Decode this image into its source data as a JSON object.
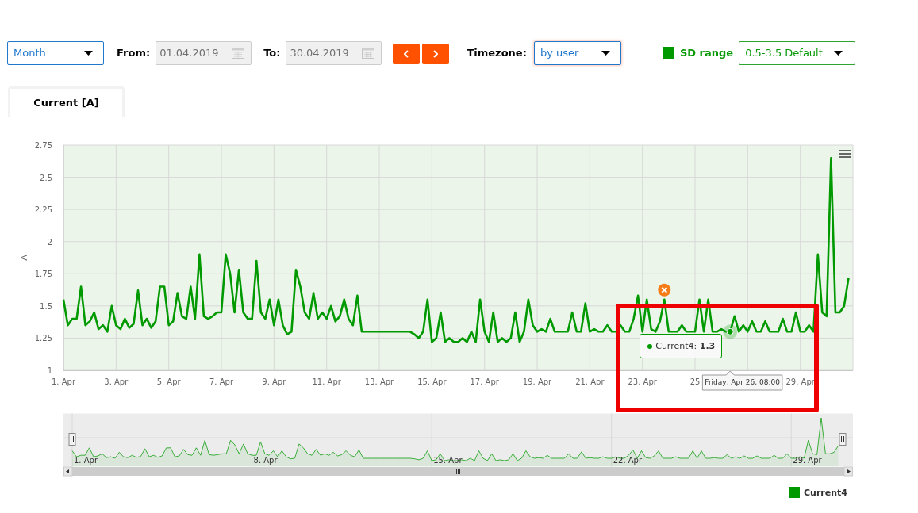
{
  "toolbar": {
    "period": {
      "value": "Month",
      "focused": false
    },
    "from": {
      "label": "From:",
      "value": "01.04.2019",
      "disabled": true
    },
    "to": {
      "label": "To:",
      "value": "30.04.2019",
      "disabled": true
    },
    "steps": [
      {
        "kind": "prev"
      },
      {
        "kind": "next"
      }
    ],
    "timezone": {
      "label": "Timezone:",
      "value": "by user",
      "focused": true
    },
    "sd_range": {
      "label": "SD range",
      "value": "0.5-3.5 Default"
    }
  },
  "tabs": [
    {
      "label": "Current [A]",
      "selected": true
    }
  ],
  "chart": {
    "chart_data": {
      "type": "line",
      "ylabel": "A",
      "grid": true,
      "categories": [
        "1. Apr",
        null,
        null,
        null,
        null,
        null,
        null,
        null,
        null,
        null,
        null,
        null,
        "3. Apr",
        null,
        null,
        null,
        null,
        null,
        null,
        null,
        null,
        null,
        null,
        null,
        "5. Apr",
        null,
        null,
        null,
        null,
        null,
        null,
        null,
        null,
        null,
        null,
        null,
        "7. Apr",
        null,
        null,
        null,
        null,
        null,
        null,
        null,
        null,
        null,
        null,
        null,
        "9. Apr",
        null,
        null,
        null,
        null,
        null,
        null,
        null,
        null,
        null,
        null,
        null,
        "11. Apr",
        null,
        null,
        null,
        null,
        null,
        null,
        null,
        null,
        null,
        null,
        null,
        "13. Apr",
        null,
        null,
        null,
        null,
        null,
        null,
        null,
        null,
        null,
        null,
        null,
        "15. Apr",
        null,
        null,
        null,
        null,
        null,
        null,
        null,
        null,
        null,
        null,
        null,
        "17. Apr",
        null,
        null,
        null,
        null,
        null,
        null,
        null,
        null,
        null,
        null,
        null,
        "19. Apr",
        null,
        null,
        null,
        null,
        null,
        null,
        null,
        null,
        null,
        null,
        null,
        "21. Apr",
        null,
        null,
        null,
        null,
        null,
        null,
        null,
        null,
        null,
        null,
        null,
        "23. Apr",
        null,
        null,
        null,
        null,
        null,
        null,
        null,
        null,
        null,
        null,
        null,
        "25",
        null,
        null,
        null,
        null,
        null,
        null,
        null,
        null,
        null,
        null,
        null,
        null,
        null,
        null,
        null,
        null,
        null,
        null,
        null,
        null,
        null,
        null,
        null,
        "29. Apr",
        null,
        null,
        null,
        null,
        null,
        null,
        null,
        null,
        null,
        null,
        null
      ],
      "series": [
        {
          "name": "Current4",
          "color": "#009900",
          "values": [
            1.55,
            1.35,
            1.4,
            1.4,
            1.65,
            1.35,
            1.38,
            1.45,
            1.32,
            1.35,
            1.3,
            1.5,
            1.35,
            1.32,
            1.4,
            1.33,
            1.36,
            1.62,
            1.35,
            1.4,
            1.33,
            1.38,
            1.65,
            1.65,
            1.35,
            1.38,
            1.6,
            1.42,
            1.4,
            1.65,
            1.4,
            1.9,
            1.42,
            1.4,
            1.42,
            1.45,
            1.45,
            1.9,
            1.75,
            1.45,
            1.78,
            1.45,
            1.4,
            1.4,
            1.85,
            1.45,
            1.4,
            1.55,
            1.35,
            1.55,
            1.35,
            1.28,
            1.3,
            1.78,
            1.65,
            1.45,
            1.4,
            1.6,
            1.4,
            1.45,
            1.4,
            1.5,
            1.38,
            1.42,
            1.55,
            1.4,
            1.35,
            1.58,
            1.3,
            1.3,
            1.3,
            1.3,
            1.3,
            1.3,
            1.3,
            1.3,
            1.3,
            1.3,
            1.3,
            1.3,
            1.28,
            1.25,
            1.3,
            1.55,
            1.22,
            1.25,
            1.45,
            1.22,
            1.25,
            1.22,
            1.22,
            1.25,
            1.22,
            1.3,
            1.22,
            1.55,
            1.3,
            1.22,
            1.45,
            1.22,
            1.25,
            1.22,
            1.25,
            1.45,
            1.22,
            1.3,
            1.55,
            1.35,
            1.3,
            1.32,
            1.3,
            1.4,
            1.3,
            1.3,
            1.3,
            1.3,
            1.45,
            1.3,
            1.3,
            1.52,
            1.3,
            1.32,
            1.3,
            1.3,
            1.35,
            1.3,
            1.3,
            1.35,
            1.3,
            1.3,
            1.4,
            1.58,
            1.3,
            1.55,
            1.32,
            1.3,
            1.38,
            1.55,
            1.3,
            1.3,
            1.3,
            1.35,
            1.3,
            1.3,
            1.3,
            1.55,
            1.3,
            1.55,
            1.3,
            1.3,
            1.32,
            1.3,
            1.3,
            1.42,
            1.3,
            1.35,
            1.3,
            1.38,
            1.3,
            1.3,
            1.38,
            1.3,
            1.3,
            1.3,
            1.4,
            1.3,
            1.3,
            1.45,
            1.3,
            1.3,
            1.35,
            1.3,
            1.9,
            1.45,
            1.42,
            2.65,
            1.45,
            1.45,
            1.5,
            1.72
          ]
        }
      ],
      "ylim": [
        1,
        2.75
      ],
      "yticks": [
        1,
        1.25,
        1.5,
        1.75,
        2,
        2.25,
        2.5,
        2.75
      ],
      "annotations": [
        "Current4: **1.3**",
        "Friday, Apr 26, 08:00"
      ]
    },
    "highlight_frame": true
  },
  "navigator": {
    "labels": [
      "1. Apr",
      "8. Apr",
      "15. Apr",
      "22. Apr",
      "29. Apr"
    ]
  }
}
